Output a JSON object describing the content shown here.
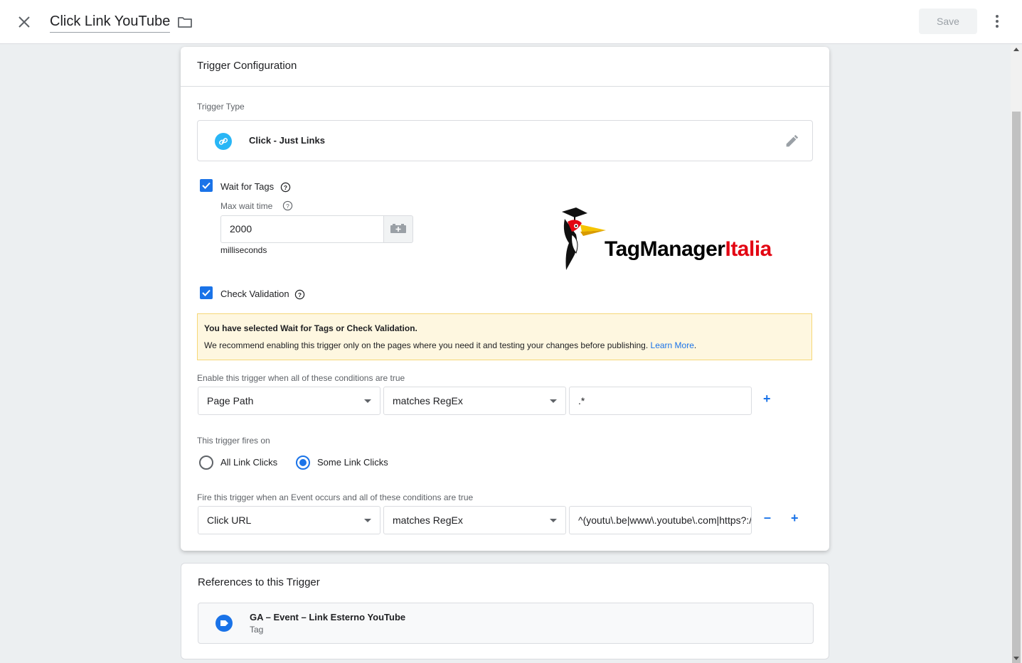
{
  "header": {
    "title": "Click Link YouTube",
    "save_label": "Save"
  },
  "config": {
    "heading": "Trigger Configuration",
    "trigger_type_label": "Trigger Type",
    "trigger_type_name": "Click - Just Links",
    "wait_for_tags_label": "Wait for Tags",
    "max_wait_label": "Max wait time",
    "max_wait_value": "2000",
    "wait_unit": "milliseconds",
    "check_validation_label": "Check Validation",
    "warning_title": "You have selected Wait for Tags or Check Validation.",
    "warning_body": "We recommend enabling this trigger only on the pages where you need it and testing your changes before publishing.",
    "learn_more": "Learn More",
    "enable_label": "Enable this trigger when all of these conditions are true",
    "enable_condition": {
      "variable": "Page Path",
      "operator": "matches RegEx",
      "value": ".*"
    },
    "fires_on_label": "This trigger fires on",
    "radio_all": "All Link Clicks",
    "radio_some": "Some Link Clicks",
    "fire_label": "Fire this trigger when an Event occurs and all of these conditions are true",
    "fire_condition": {
      "variable": "Click URL",
      "operator": "matches RegEx",
      "value": "^(youtu\\.be|www\\.youtube\\.com|https?://)"
    },
    "plus": "+",
    "minus": "–"
  },
  "logo": {
    "part1": "TagManager",
    "part2": "Italia"
  },
  "references": {
    "heading": "References to this Trigger",
    "tag_name": "GA – Event – Link Esterno YouTube",
    "tag_type": "Tag"
  },
  "icons": {
    "close": "close-icon",
    "folder": "folder-icon",
    "more": "more-vert-icon",
    "link": "link-icon",
    "edit": "pencil-icon",
    "help": "help-icon",
    "variable": "variable-icon",
    "tag": "tag-icon"
  },
  "colors": {
    "accent": "#1a73e8",
    "link_circle": "#29b6f6",
    "warning_bg": "#fef7e0",
    "logo_red": "#e30613"
  }
}
